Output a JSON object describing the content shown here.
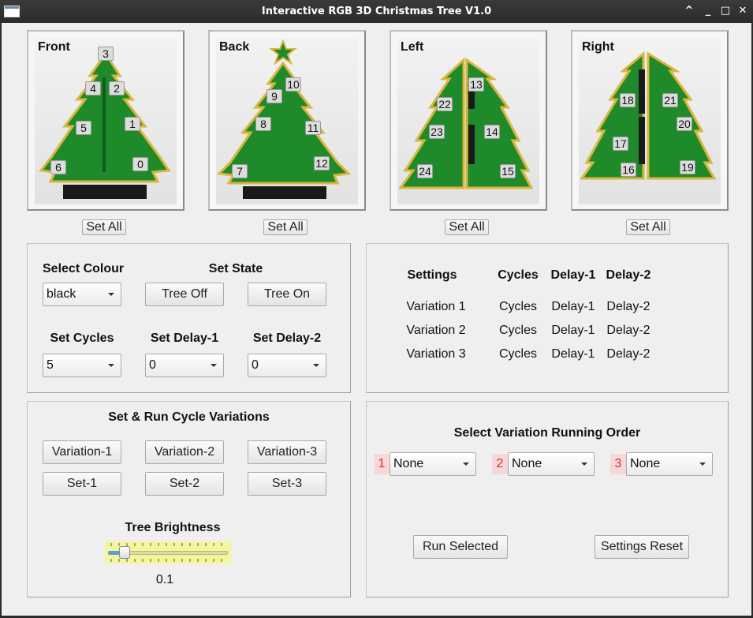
{
  "window": {
    "title": "Interactive RGB 3D Christmas Tree V1.0",
    "controls": [
      "^",
      "_",
      "□",
      "✕"
    ]
  },
  "views": [
    {
      "label": "Front",
      "set_all": "Set All",
      "leds": [
        "3",
        "4",
        "2",
        "5",
        "1",
        "6",
        "0"
      ]
    },
    {
      "label": "Back",
      "set_all": "Set All",
      "leds": [
        "10",
        "9",
        "8",
        "11",
        "7",
        "12"
      ]
    },
    {
      "label": "Left",
      "set_all": "Set All",
      "leds": [
        "13",
        "22",
        "23",
        "14",
        "24",
        "15"
      ]
    },
    {
      "label": "Right",
      "set_all": "Set All",
      "leds": [
        "18",
        "21",
        "20",
        "17",
        "16",
        "19"
      ]
    }
  ],
  "controls": {
    "select_colour_label": "Select Colour",
    "colour_value": "black",
    "set_state_label": "Set State",
    "tree_off": "Tree Off",
    "tree_on": "Tree On",
    "set_cycles_label": "Set Cycles",
    "cycles_value": "5",
    "set_delay1_label": "Set Delay-1",
    "delay1_value": "0",
    "set_delay2_label": "Set Delay-2",
    "delay2_value": "0"
  },
  "settings_table": {
    "headers": [
      "Settings",
      "Cycles",
      "Delay-1",
      "Delay-2"
    ],
    "rows": [
      [
        "Variation 1",
        "Cycles",
        "Delay-1",
        "Delay-2"
      ],
      [
        "Variation 2",
        "Cycles",
        "Delay-1",
        "Delay-2"
      ],
      [
        "Variation 3",
        "Cycles",
        "Delay-1",
        "Delay-2"
      ]
    ]
  },
  "variations": {
    "title": "Set & Run Cycle Variations",
    "run_buttons": [
      "Variation-1",
      "Variation-2",
      "Variation-3"
    ],
    "set_buttons": [
      "Set-1",
      "Set-2",
      "Set-3"
    ],
    "brightness_label": "Tree Brightness",
    "brightness_value": "0.1",
    "brightness_level": 0.1
  },
  "running_order": {
    "title": "Select Variation Running Order",
    "slots": [
      {
        "number": "1",
        "value": "None"
      },
      {
        "number": "2",
        "value": "None"
      },
      {
        "number": "3",
        "value": "None"
      }
    ],
    "run_selected": "Run Selected",
    "settings_reset": "Settings Reset"
  },
  "colors": {
    "pcb_green": "#1e8a2a",
    "pcb_edge": "#d9b53a",
    "slider_bg": "#f5f59a",
    "slider_fill": "#57a0d8",
    "badge_bg": "#f7d7d7"
  }
}
